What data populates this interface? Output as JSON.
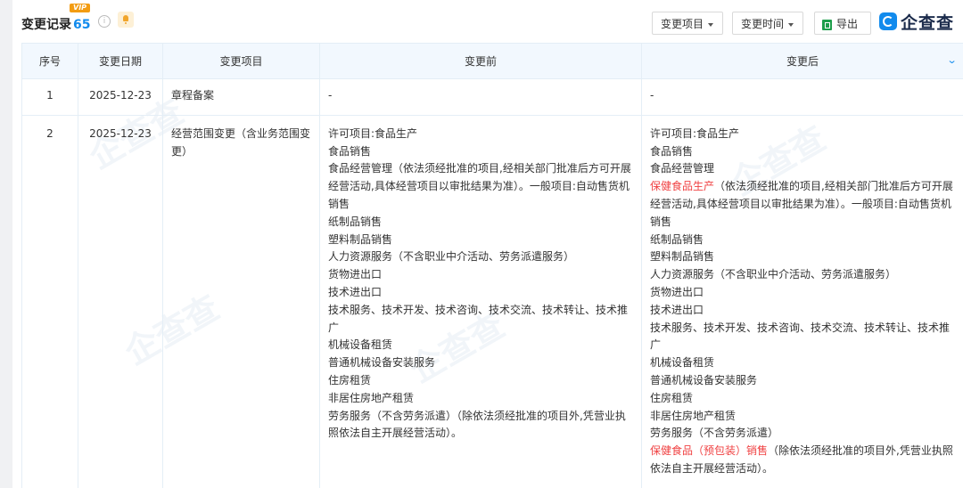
{
  "header": {
    "title": "变更记录",
    "count": "65",
    "vip_badge": "VIP",
    "info_symbol": "i",
    "buttons": {
      "change_items": "变更项目",
      "change_time": "变更时间",
      "export": "导出"
    },
    "logo_text": "企查查"
  },
  "table": {
    "columns": [
      "序号",
      "变更日期",
      "变更项目",
      "变更前",
      "变更后"
    ],
    "rows": [
      {
        "index": "1",
        "date": "2025-12-23",
        "item": "章程备案",
        "before": [
          "-"
        ],
        "after": [
          "-"
        ]
      },
      {
        "index": "2",
        "date": "2025-12-23",
        "item": "经营范围变更（含业务范围变更）",
        "before": [
          "许可项目:食品生产",
          "食品销售",
          "食品经营管理（依法须经批准的项目,经相关部门批准后方可开展经营活动,具体经营项目以审批结果为准）。一般项目:自动售货机销售",
          "纸制品销售",
          "塑料制品销售",
          "人力资源服务（不含职业中介活动、劳务派遣服务）",
          "货物进出口",
          "技术进出口",
          "技术服务、技术开发、技术咨询、技术交流、技术转让、技术推广",
          "机械设备租赁",
          "普通机械设备安装服务",
          "住房租赁",
          "非居住房地产租赁",
          "劳务服务（不含劳务派遣）（除依法须经批准的项目外,凭营业执照依法自主开展经营活动）。"
        ],
        "after": [
          "许可项目:食品生产",
          "食品销售",
          "食品经营管理",
          {
            "hl": "保健食品生产",
            "rest": "（依法须经批准的项目,经相关部门批准后方可开展经营活动,具体经营项目以审批结果为准）。一般项目:自动售货机销售"
          },
          "纸制品销售",
          "塑料制品销售",
          "人力资源服务（不含职业中介活动、劳务派遣服务）",
          "货物进出口",
          "技术进出口",
          "技术服务、技术开发、技术咨询、技术交流、技术转让、技术推广",
          "机械设备租赁",
          "普通机械设备安装服务",
          "住房租赁",
          "非居住房地产租赁",
          "劳务服务（不含劳务派遣）",
          {
            "hl": "保健食品（预包装）销售",
            "rest": "（除依法须经批准的项目外,凭营业执照依法自主开展经营活动）。"
          }
        ]
      }
    ]
  },
  "colors": {
    "accent": "#128bed",
    "highlight": "#f04142",
    "header_bg": "#f2f8fe"
  }
}
